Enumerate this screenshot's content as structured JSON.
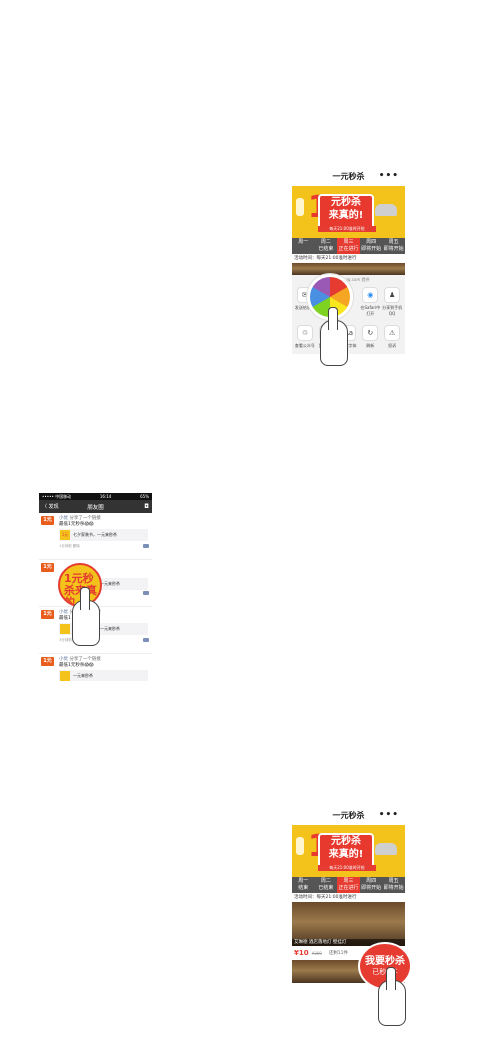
{
  "panel_top": {
    "title": "一元秒杀",
    "more": "•••",
    "banner_big": "1",
    "banner_title": "元秒杀",
    "banner_title2": "来真的!",
    "banner_sub": "每天21:00准时开抢",
    "tabs": [
      {
        "line1": "周一",
        "line2": ""
      },
      {
        "line1": "周二",
        "line2": "已结束"
      },
      {
        "line1": "周三",
        "line2": "正在进行"
      },
      {
        "line1": "周四",
        "line2": "即将开始"
      },
      {
        "line1": "周五",
        "line2": "即将开始"
      }
    ],
    "notice": "活动时间：每天21:00准时进行",
    "share_host": "...weixin.qq.com 提供",
    "share_row1": [
      {
        "icon": "✉",
        "label": "发送给朋友"
      },
      {
        "icon": "",
        "label": ""
      },
      {
        "icon": "",
        "label": ""
      },
      {
        "icon": "◉",
        "label": "在Safari中打开"
      },
      {
        "icon": "♟",
        "label": "分享到手机QQ"
      }
    ],
    "share_row2": [
      {
        "icon": "♲",
        "label": "查看公众号"
      },
      {
        "icon": "",
        "label": "复制链接"
      },
      {
        "icon": "Aa",
        "label": "调整字体"
      },
      {
        "icon": "↻",
        "label": "刷新"
      },
      {
        "icon": "⚠",
        "label": "投诉"
      }
    ]
  },
  "panel_mid": {
    "status_left": "••••• 中国移动",
    "status_time": "16:14",
    "status_right": "65%",
    "back": "〈 发现",
    "title": "朋友圈",
    "camera": "◘",
    "posts": [
      {
        "logo": "1元",
        "name": "小优",
        "action": "分享了一个链接",
        "text": "最低1元秒杀😱😱",
        "card": "七夕家装节，一元来秒杀",
        "meta": "1分钟前   删除"
      },
      {
        "logo": "1元",
        "name": "",
        "action": "",
        "text": "",
        "card": "一元来秒杀",
        "meta": ""
      },
      {
        "logo": "1元",
        "name": "小优",
        "action": "分享了一个链接",
        "text": "最低1",
        "card": "一元来秒杀",
        "meta": "3分钟前   删除"
      },
      {
        "logo": "1元",
        "name": "小优",
        "action": "分享了一个链接",
        "text": "最低1元秒杀😱😱",
        "card": "一元来秒杀",
        "meta": ""
      }
    ],
    "badge_text": "1元秒杀来真的"
  },
  "panel_bottom": {
    "title": "一元秒杀",
    "more": "•••",
    "banner_big": "1",
    "banner_title": "元秒杀",
    "banner_title2": "来真的!",
    "banner_sub": "每天21:00准时开抢",
    "tabs": [
      {
        "line1": "周一",
        "line2": "结束"
      },
      {
        "line1": "周二",
        "line2": "已结束"
      },
      {
        "line1": "周三",
        "line2": "正在进行"
      },
      {
        "line1": "周四",
        "line2": "即将开始"
      },
      {
        "line1": "周五",
        "line2": "即将开始"
      }
    ],
    "notice": "活动时间：每天21:00准时进行",
    "product_title": "艾琳德 酒店落地灯 壁挂灯",
    "price": "¥10",
    "orig_price": "¥369",
    "sold": "还剩11件",
    "buy_line1": "我要秒杀",
    "buy_line2": "已秒3件"
  }
}
